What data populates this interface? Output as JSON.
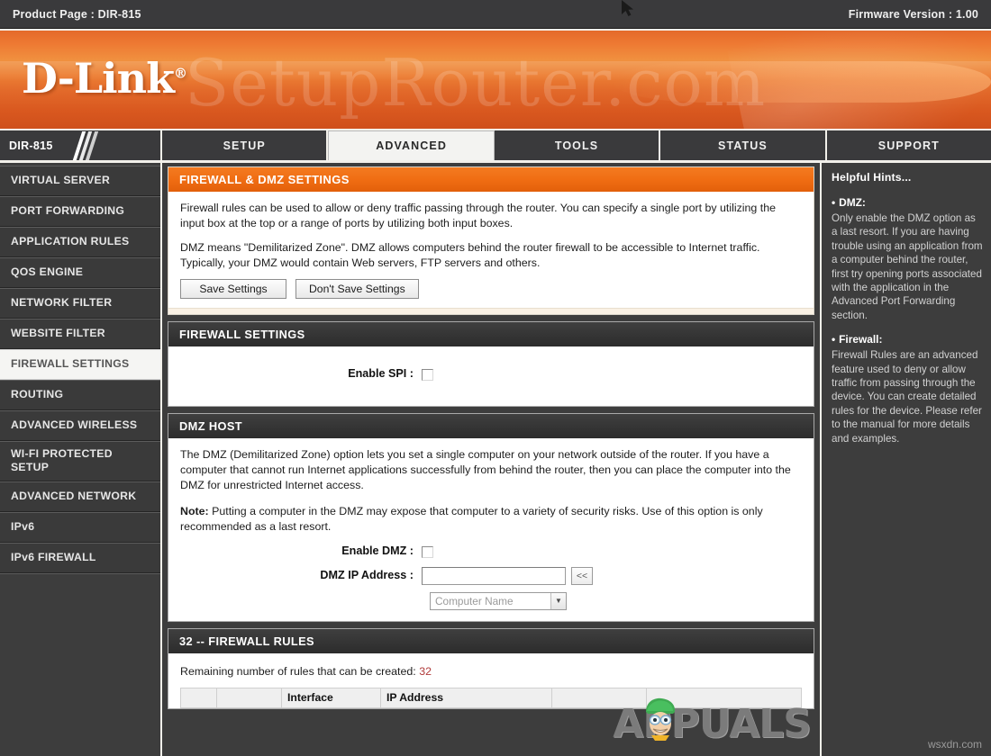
{
  "topbar": {
    "product_page": "Product Page : DIR-815",
    "firmware": "Firmware Version : 1.00"
  },
  "banner": {
    "logo": "D-Link",
    "logo_tm": "®",
    "watermark": "SetupRouter.com"
  },
  "nav": {
    "model": "DIR-815",
    "tabs": [
      {
        "label": "SETUP",
        "active": false
      },
      {
        "label": "ADVANCED",
        "active": true
      },
      {
        "label": "TOOLS",
        "active": false
      },
      {
        "label": "STATUS",
        "active": false
      },
      {
        "label": "SUPPORT",
        "active": false
      }
    ]
  },
  "sidebar": {
    "items": [
      {
        "label": "VIRTUAL SERVER",
        "active": false
      },
      {
        "label": "PORT FORWARDING",
        "active": false
      },
      {
        "label": "APPLICATION RULES",
        "active": false
      },
      {
        "label": "QOS ENGINE",
        "active": false
      },
      {
        "label": "NETWORK FILTER",
        "active": false
      },
      {
        "label": "WEBSITE FILTER",
        "active": false
      },
      {
        "label": "FIREWALL SETTINGS",
        "active": true
      },
      {
        "label": "ROUTING",
        "active": false
      },
      {
        "label": "ADVANCED WIRELESS",
        "active": false
      },
      {
        "label": "WI-FI PROTECTED SETUP",
        "active": false
      },
      {
        "label": "ADVANCED NETWORK",
        "active": false
      },
      {
        "label": "IPv6",
        "active": false
      },
      {
        "label": "IPv6 FIREWALL",
        "active": false
      }
    ]
  },
  "main": {
    "intro": {
      "title": "FIREWALL & DMZ SETTINGS",
      "para1": "Firewall rules can be used to allow or deny traffic passing through the router. You can specify a single port by utilizing the input box at the top or a range of ports by utilizing both input boxes.",
      "para2": "DMZ means \"Demilitarized Zone\". DMZ allows computers behind the router firewall to be accessible to Internet traffic. Typically, your DMZ would contain Web servers, FTP servers and others.",
      "save_label": "Save Settings",
      "dont_save_label": "Don't Save Settings"
    },
    "firewall_settings": {
      "title": "FIREWALL SETTINGS",
      "enable_spi_label": "Enable SPI :",
      "enable_spi_checked": false
    },
    "dmz_host": {
      "title": "DMZ HOST",
      "para1": "The DMZ (Demilitarized Zone) option lets you set a single computer on your network outside of the router. If you have a computer that cannot run Internet applications successfully from behind the router, then you can place the computer into the DMZ for unrestricted Internet access.",
      "note_label": "Note:",
      "note_text": " Putting a computer in the DMZ may expose that computer to a variety of security risks. Use of this option is only recommended as a last resort.",
      "enable_dmz_label": "Enable DMZ :",
      "enable_dmz_checked": false,
      "dmz_ip_label": "DMZ IP Address :",
      "dmz_ip_value": "",
      "dmz_ip_placeholder": "",
      "copy_button_label": "<<",
      "computer_name_selected": "Computer Name"
    },
    "firewall_rules": {
      "title": "32 -- FIREWALL RULES",
      "remaining_label": "Remaining number of rules that can be created:",
      "remaining_count": "32",
      "columns": [
        "",
        "",
        "Interface",
        "IP Address",
        "",
        ""
      ]
    }
  },
  "hints": {
    "title": "Helpful Hints...",
    "blocks": [
      {
        "bullet": "•",
        "heading": "DMZ:",
        "text": "Only enable the DMZ option as a last resort. If you are having trouble using an application from a computer behind the router, first try opening ports associated with the application in the Advanced Port Forwarding section."
      },
      {
        "bullet": "•",
        "heading": "Firewall:",
        "text": "Firewall Rules are an advanced feature used to deny or allow traffic from passing through the device. You can create detailed rules for the device. Please refer to the manual for more details and examples."
      }
    ]
  },
  "watermarks": {
    "appuals": "APPUALS",
    "wsxdn": "wsxdn.com"
  }
}
